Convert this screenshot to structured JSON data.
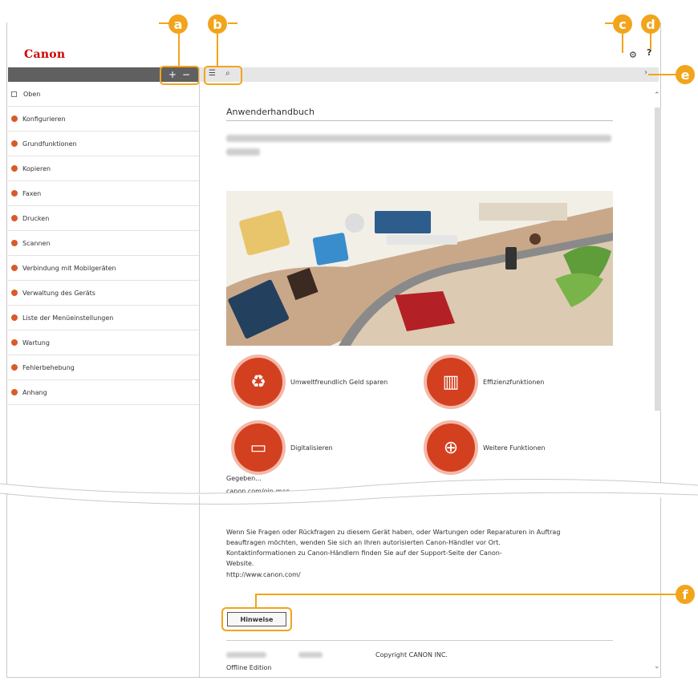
{
  "brand": {
    "logo_text": "Canon"
  },
  "callouts": {
    "a": "a",
    "b": "b",
    "c": "c",
    "d": "d",
    "e": "e",
    "f": "f"
  },
  "sidebar": {
    "expand_label": "+",
    "collapse_label": "−",
    "items": [
      {
        "label": "Oben",
        "marker": "square"
      },
      {
        "label": "Konfigurieren",
        "marker": "dot"
      },
      {
        "label": "Grundfunktionen",
        "marker": "dot"
      },
      {
        "label": "Kopieren",
        "marker": "dot"
      },
      {
        "label": "Faxen",
        "marker": "dot"
      },
      {
        "label": "Drucken",
        "marker": "dot"
      },
      {
        "label": "Scannen",
        "marker": "dot"
      },
      {
        "label": "Verbindung mit Mobilgeräten",
        "marker": "dot"
      },
      {
        "label": "Verwaltung des Geräts",
        "marker": "dot"
      },
      {
        "label": "Liste der Menüeinstellungen",
        "marker": "dot"
      },
      {
        "label": "Wartung",
        "marker": "dot"
      },
      {
        "label": "Fehlerbehebung",
        "marker": "dot"
      },
      {
        "label": "Anhang",
        "marker": "dot"
      }
    ]
  },
  "toolbar": {
    "toc_icon": "☰",
    "search_icon": "⌕",
    "settings_icon": "⚙",
    "help_icon": "?",
    "collapse_icon": "›"
  },
  "main": {
    "title": "Anwenderhandbuch",
    "features": [
      {
        "label": "Umweltfreundlich Geld sparen",
        "icon": "♻"
      },
      {
        "label": "Effizienzfunktionen",
        "icon": "▥"
      },
      {
        "label": "Digitalisieren",
        "icon": "▭"
      },
      {
        "label": "Weitere Funktionen",
        "icon": "⊕"
      }
    ],
    "partial_line_1": "Gegeben...",
    "partial_line_2": "canon.com/oip-man...",
    "support_lines": [
      "Wenn Sie Fragen oder Rückfragen zu diesem Gerät haben, oder Wartungen oder Reparaturen in Auftrag",
      "beauftragen möchten, wenden Sie sich an Ihren autorisierten Canon-Händler vor Ort.",
      "Kontaktinformationen zu Canon-Händlern finden Sie auf der Support-Seite der Canon-",
      "Website.",
      "http://www.canon.com/"
    ],
    "notes_button": "Hinweise",
    "copyright": "Copyright CANON INC.",
    "edition": "Offline Edition"
  }
}
